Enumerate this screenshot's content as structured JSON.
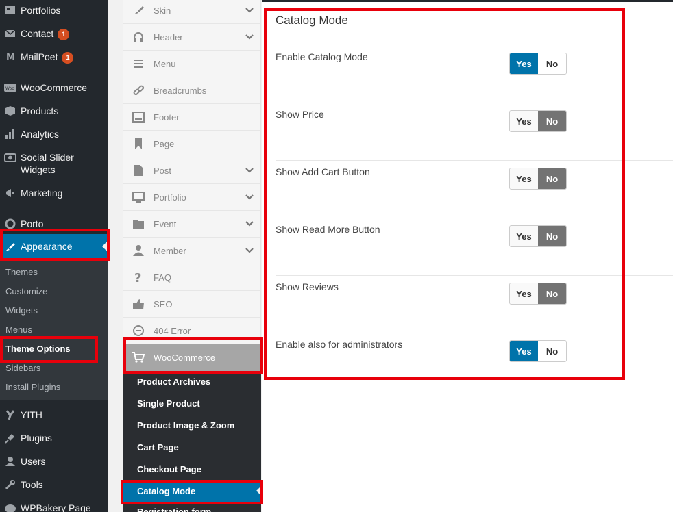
{
  "admin_menu": {
    "items": [
      {
        "label": "Portfolios",
        "icon": "portfolio-icon"
      },
      {
        "label": "Contact",
        "icon": "mail-icon",
        "badge": "1"
      },
      {
        "label": "MailPoet",
        "icon": "mailpoet-icon",
        "badge": "1"
      },
      {
        "label": "WooCommerce",
        "icon": "woocommerce-icon"
      },
      {
        "label": "Products",
        "icon": "box-icon"
      },
      {
        "label": "Analytics",
        "icon": "bar-chart-icon"
      },
      {
        "label": "Social Slider Widgets",
        "icon": "slider-icon"
      },
      {
        "label": "Marketing",
        "icon": "megaphone-icon"
      },
      {
        "label": "Porto",
        "icon": "porto-icon"
      },
      {
        "label": "Appearance",
        "icon": "paintbrush-icon"
      },
      {
        "label": "YITH",
        "icon": "yith-icon"
      },
      {
        "label": "Plugins",
        "icon": "plug-icon"
      },
      {
        "label": "Users",
        "icon": "user-icon"
      },
      {
        "label": "Tools",
        "icon": "wrench-icon"
      },
      {
        "label": "WPBakery Page",
        "icon": "wpbakery-icon"
      }
    ],
    "appearance_submenu": [
      "Themes",
      "Customize",
      "Widgets",
      "Menus",
      "Theme Options",
      "Sidebars",
      "Install Plugins"
    ]
  },
  "theme_nav": {
    "items": [
      {
        "label": "Skin",
        "icon": "brush-icon"
      },
      {
        "label": "Header",
        "icon": "headphones-icon"
      },
      {
        "label": "Menu",
        "icon": "hamburger-icon"
      },
      {
        "label": "Breadcrumbs",
        "icon": "link-icon"
      },
      {
        "label": "Footer",
        "icon": "footer-icon"
      },
      {
        "label": "Page",
        "icon": "bookmark-icon"
      },
      {
        "label": "Post",
        "icon": "document-icon"
      },
      {
        "label": "Portfolio",
        "icon": "monitor-icon"
      },
      {
        "label": "Event",
        "icon": "folder-icon"
      },
      {
        "label": "Member",
        "icon": "person-icon"
      },
      {
        "label": "FAQ",
        "icon": "question-icon"
      },
      {
        "label": "SEO",
        "icon": "thumbs-up-icon"
      },
      {
        "label": "404 Error",
        "icon": "minus-circle-icon"
      }
    ],
    "woocommerce": {
      "label": "WooCommerce",
      "icon": "cart-icon"
    },
    "woo_submenu": [
      "Product Archives",
      "Single Product",
      "Product Image & Zoom",
      "Cart Page",
      "Checkout Page",
      "Catalog Mode",
      "Registration form"
    ]
  },
  "catalog_mode": {
    "title": "Catalog Mode",
    "options": [
      {
        "label": "Enable Catalog Mode",
        "yes": "Yes",
        "no": "No",
        "value": "Yes"
      },
      {
        "label": "Show Price",
        "yes": "Yes",
        "no": "No",
        "value": "No"
      },
      {
        "label": "Show Add Cart Button",
        "yes": "Yes",
        "no": "No",
        "value": "No"
      },
      {
        "label": "Show Read More Button",
        "yes": "Yes",
        "no": "No",
        "value": "No"
      },
      {
        "label": "Show Reviews",
        "yes": "Yes",
        "no": "No",
        "value": "No"
      },
      {
        "label": "Enable also for administrators",
        "yes": "Yes",
        "no": "No",
        "value": "Yes"
      }
    ]
  },
  "colors": {
    "accent": "#0073aa",
    "admin_bg": "#23282d",
    "highlight": "#e8000b"
  }
}
